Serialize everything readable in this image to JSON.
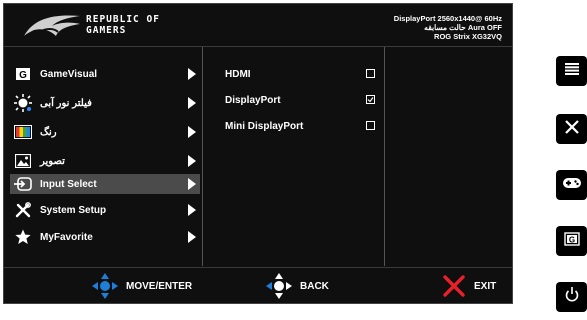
{
  "brand": {
    "line1": "REPUBLIC OF",
    "line2": "GAMERS"
  },
  "status": {
    "line1": "DisplayPort 2560x1440@ 60Hz",
    "line2": "حالت مسابقه Aura OFF",
    "line3": "ROG Strix XG32VQ"
  },
  "menu": [
    {
      "label": "GameVisual",
      "icon": "gamevisual-icon"
    },
    {
      "label": "فیلتر نور آبی",
      "icon": "blue-light-filter-icon"
    },
    {
      "label": "رنگ",
      "icon": "color-icon"
    },
    {
      "label": "تصویر",
      "icon": "image-icon"
    },
    {
      "label": "Input Select",
      "icon": "input-select-icon",
      "selected": true
    },
    {
      "label": "System Setup",
      "icon": "system-setup-icon"
    },
    {
      "label": "MyFavorite",
      "icon": "star-icon"
    }
  ],
  "submenu": [
    {
      "label": "HDMI",
      "checked": false
    },
    {
      "label": "DisplayPort",
      "checked": true
    },
    {
      "label": "Mini DisplayPort",
      "checked": false
    }
  ],
  "footer": {
    "move": "MOVE/ENTER",
    "back": "BACK",
    "exit": "EXIT"
  },
  "colors": {
    "background": "#0f0f0f",
    "selected": "#4b4b4b",
    "accent_blue": "#1e7fd8",
    "exit_red": "#e8202a"
  },
  "side_buttons": [
    "menu-icon",
    "close-icon",
    "gamepad-icon",
    "gamevisual-icon",
    "power-icon"
  ]
}
